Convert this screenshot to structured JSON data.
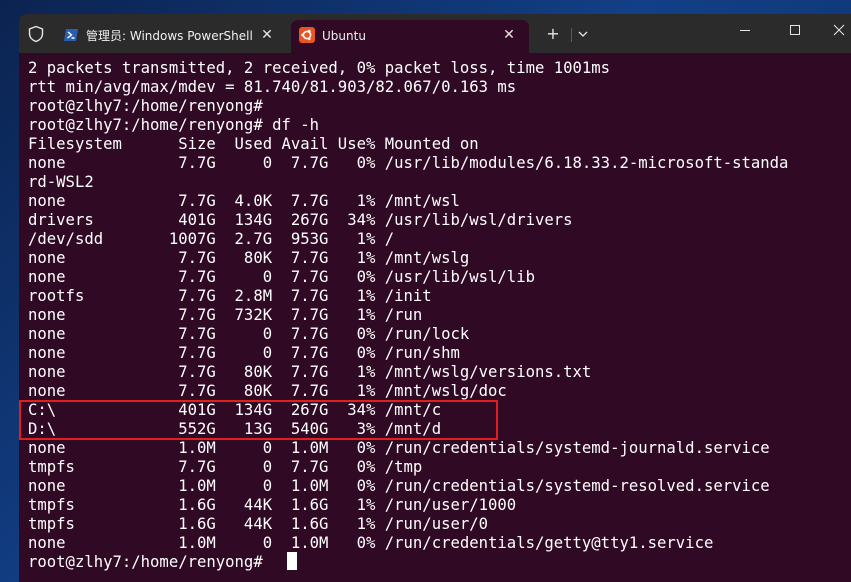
{
  "tabs": [
    {
      "label": "管理员: Windows PowerShell",
      "icon": "powershell-icon",
      "active": false
    },
    {
      "label": "Ubuntu",
      "icon": "ubuntu-icon",
      "active": true
    }
  ],
  "titlebar": {
    "new_tab_symbol": "+",
    "close_symbol": "✕"
  },
  "terminal": {
    "lines": [
      "2 packets transmitted, 2 received, 0% packet loss, time 1001ms",
      "rtt min/avg/max/mdev = 81.740/81.903/82.067/0.163 ms",
      "root@zlhy7:/home/renyong#",
      "root@zlhy7:/home/renyong# df -h",
      "Filesystem      Size  Used Avail Use% Mounted on",
      "none            7.7G     0  7.7G   0% /usr/lib/modules/6.18.33.2-microsoft-standa",
      "rd-WSL2",
      "none            7.7G  4.0K  7.7G   1% /mnt/wsl",
      "drivers         401G  134G  267G  34% /usr/lib/wsl/drivers",
      "/dev/sdd       1007G  2.7G  953G   1% /",
      "none            7.7G   80K  7.7G   1% /mnt/wslg",
      "none            7.7G     0  7.7G   0% /usr/lib/wsl/lib",
      "rootfs          7.7G  2.8M  7.7G   1% /init",
      "none            7.7G  732K  7.7G   1% /run",
      "none            7.7G     0  7.7G   0% /run/lock",
      "none            7.7G     0  7.7G   0% /run/shm",
      "none            7.7G   80K  7.7G   1% /mnt/wslg/versions.txt",
      "none            7.7G   80K  7.7G   1% /mnt/wslg/doc",
      "C:\\             401G  134G  267G  34% /mnt/c",
      "D:\\             552G   13G  540G   3% /mnt/d",
      "none            1.0M     0  1.0M   0% /run/credentials/systemd-journald.service",
      "tmpfs           7.7G     0  7.7G   0% /tmp",
      "none            1.0M     0  1.0M   0% /run/credentials/systemd-resolved.service",
      "tmpfs           1.6G   44K  1.6G   1% /run/user/1000",
      "tmpfs           1.6G   44K  1.6G   1% /run/user/0",
      "none            1.0M     0  1.0M   0% /run/credentials/getty@tty1.service",
      "root@zlhy7:/home/renyong#"
    ]
  },
  "colors": {
    "terminal_bg": "#300a24",
    "titlebar_bg": "#2b2b2b",
    "highlight": "#e0201d",
    "ubuntu_orange": "#e95420",
    "powershell_blue": "#2a5fb0"
  }
}
